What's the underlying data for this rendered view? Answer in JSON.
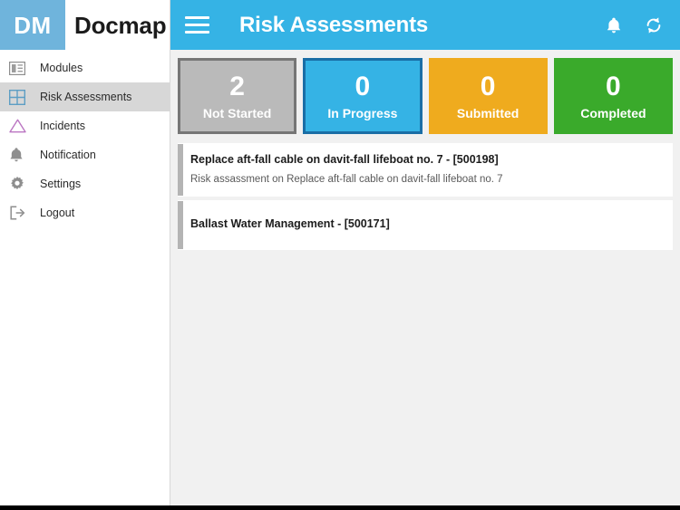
{
  "brand": {
    "badge_text": "DM",
    "name": "Docmap",
    "badge_color": "#6fb4dc"
  },
  "sidebar": {
    "items": [
      {
        "label": "Modules",
        "icon": "modules-icon",
        "active": false
      },
      {
        "label": "Risk Assessments",
        "icon": "grid-icon",
        "active": true
      },
      {
        "label": "Incidents",
        "icon": "triangle-warning-icon",
        "active": false
      },
      {
        "label": "Notification",
        "icon": "bell-icon",
        "active": false
      },
      {
        "label": "Settings",
        "icon": "gear-icon",
        "active": false
      },
      {
        "label": "Logout",
        "icon": "logout-icon",
        "active": false
      }
    ]
  },
  "topbar": {
    "title": "Risk Assessments",
    "menu_icon": "hamburger-icon",
    "notification_icon": "bell-icon",
    "sync_icon": "refresh-sync-icon",
    "background_color": "#35b3e5"
  },
  "status_tiles": [
    {
      "count": "2",
      "label": "Not Started",
      "fill": "#bababa",
      "border": "#767676"
    },
    {
      "count": "0",
      "label": "In Progress",
      "fill": "#35b3e5",
      "border": "#1a6ea6"
    },
    {
      "count": "0",
      "label": "Submitted",
      "fill": "#efab1e",
      "border": "#efab1e"
    },
    {
      "count": "0",
      "label": "Completed",
      "fill": "#3aaa2b",
      "border": "#3aaa2b"
    }
  ],
  "assessments": [
    {
      "title": "Replace aft-fall cable on davit-fall lifeboat no. 7 - [500198]",
      "subtitle": "Risk assassment on Replace aft-fall cable on davit-fall lifeboat no. 7",
      "accent_color": "#b4b4b4"
    },
    {
      "title": "Ballast Water Management - [500171]",
      "subtitle": "",
      "accent_color": "#b4b4b4"
    }
  ]
}
